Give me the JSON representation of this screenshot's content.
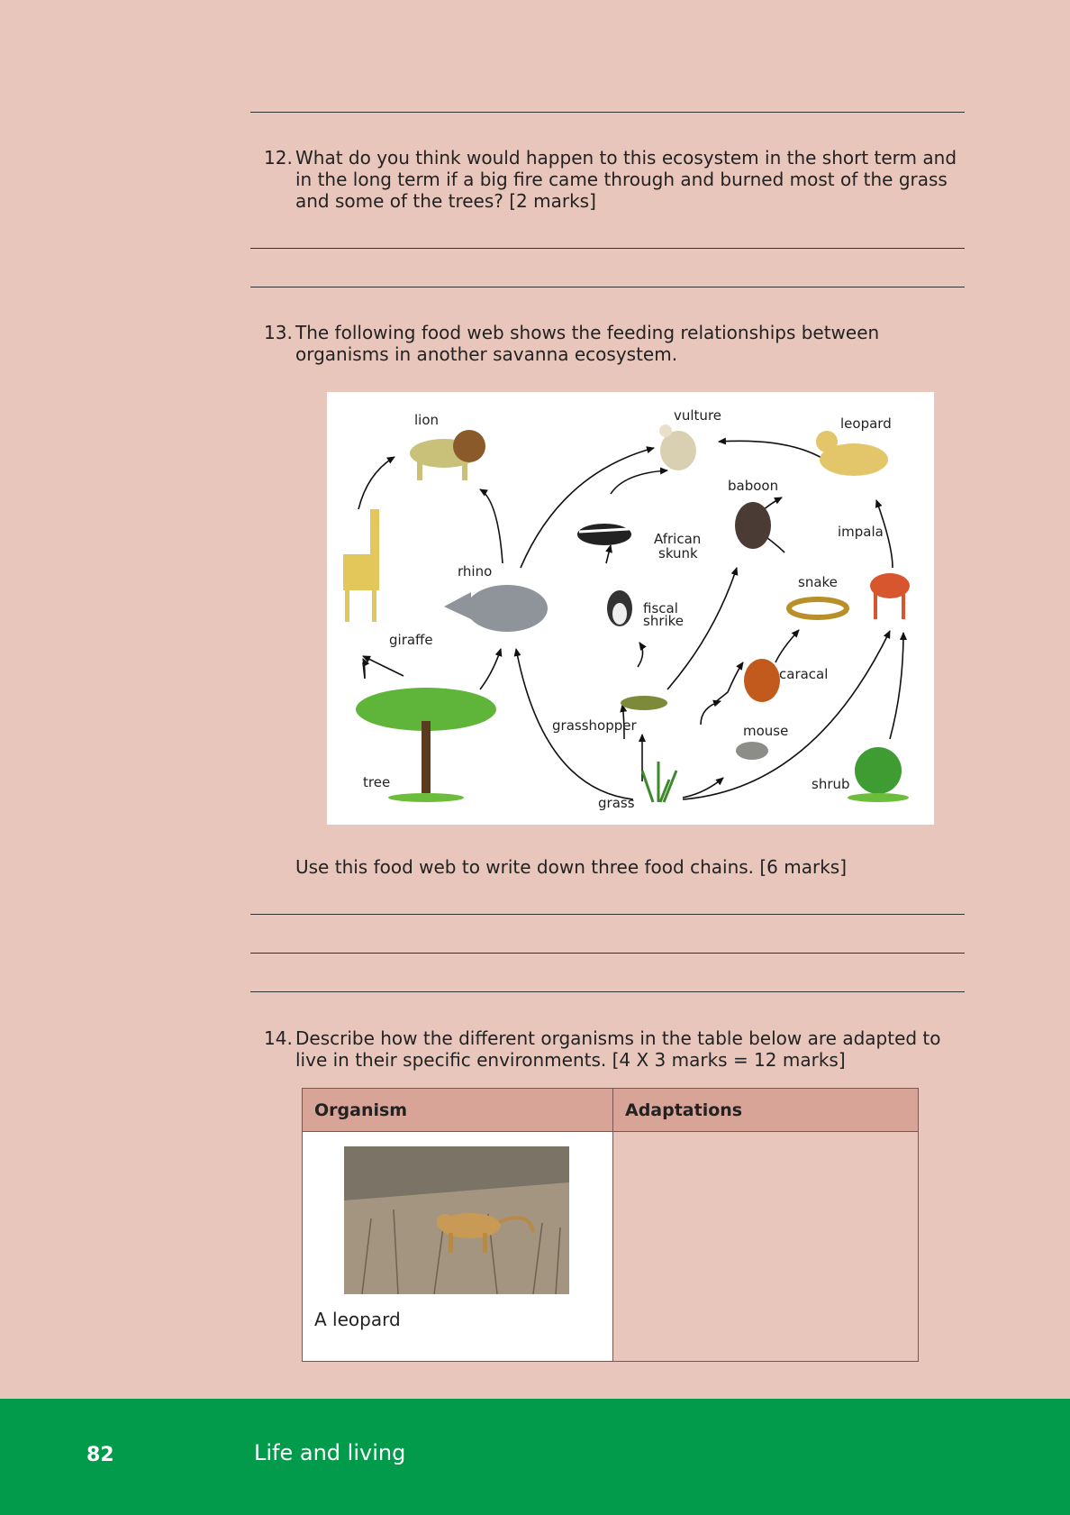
{
  "questions": [
    {
      "number": "12.",
      "text": "What do you think would happen to this ecosystem in the short term and in the long term if a big fire came through and burned most of the grass and some of the trees? [2 marks]"
    },
    {
      "number": "13.",
      "text": "The following food web shows the feeding relationships between organisms in another savanna ecosystem."
    },
    {
      "number": "14.",
      "text": "Describe how the different organisms in the table below are adapted to live in their specific environments. [4 X 3 marks = 12 marks]"
    }
  ],
  "food_web": {
    "organisms": [
      "lion",
      "vulture",
      "leopard",
      "baboon",
      "African",
      "skunk",
      "impala",
      "rhino",
      "snake",
      "fiscal",
      "shrike",
      "giraffe",
      "caracal",
      "grasshopper",
      "mouse",
      "tree",
      "shrub",
      "grass"
    ]
  },
  "instruction": "Use this food web to write down three food chains. [6 marks]",
  "table": {
    "headers": [
      "Organism",
      "Adaptations"
    ],
    "rows": [
      {
        "organism_label": "A leopard",
        "adaptations": ""
      }
    ]
  },
  "footer": {
    "page_number": "82",
    "title": "Life and living"
  }
}
